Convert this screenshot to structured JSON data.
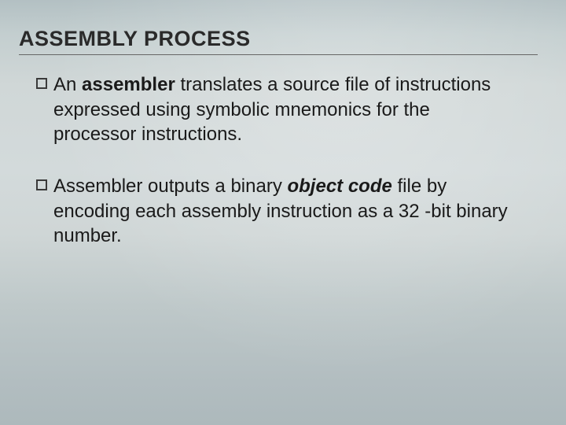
{
  "slide": {
    "title": "ASSEMBLY PROCESS",
    "bullets": [
      {
        "prefix": "An ",
        "emphasis1": "assembler",
        "mid": " translates a source file of instructions expressed using symbolic mnemonics for the processor instructions.",
        "emphasis1_style": "bold"
      },
      {
        "prefix": "Assembler outputs a binary ",
        "emphasis1": "object code",
        "mid": " file by encoding each assembly instruction as a 32 -bit binary number.",
        "emphasis1_style": "italic"
      }
    ]
  }
}
